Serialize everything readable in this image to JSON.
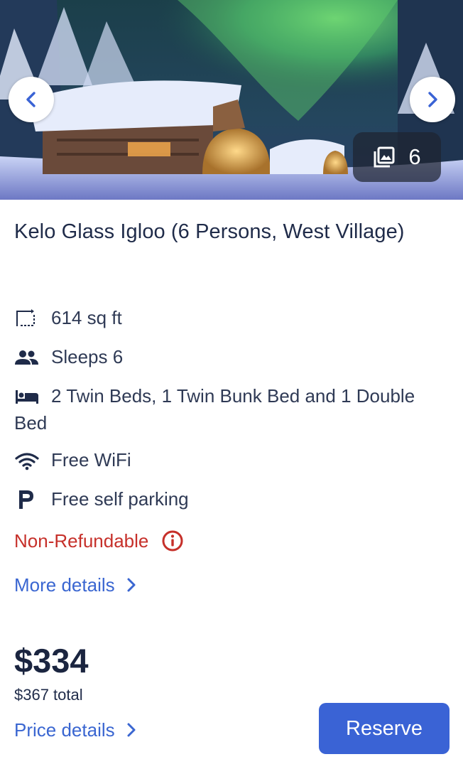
{
  "gallery": {
    "photo_count": "6"
  },
  "room": {
    "title": "Kelo Glass Igloo (6 Persons, West Village)"
  },
  "amenities": [
    {
      "icon": "floor-area-icon",
      "text": "614 sq ft"
    },
    {
      "icon": "people-icon",
      "text": "Sleeps 6"
    },
    {
      "icon": "bed-icon",
      "text": "2 Twin Beds, 1 Twin Bunk Bed and 1 Double Bed"
    },
    {
      "icon": "wifi-icon",
      "text": "Free WiFi"
    },
    {
      "icon": "parking-icon",
      "text": "Free self parking"
    }
  ],
  "policy": {
    "refund_label": "Non-Refundable",
    "icon": "info-icon"
  },
  "links": {
    "more_details": "More details",
    "price_details": "Price details"
  },
  "pricing": {
    "nightly": "$334",
    "total": "$367 total"
  },
  "actions": {
    "reserve_label": "Reserve"
  },
  "colors": {
    "accent": "#3a63d5",
    "link": "#3a66d1",
    "warning": "#c6302a",
    "text": "#1f2b49"
  }
}
